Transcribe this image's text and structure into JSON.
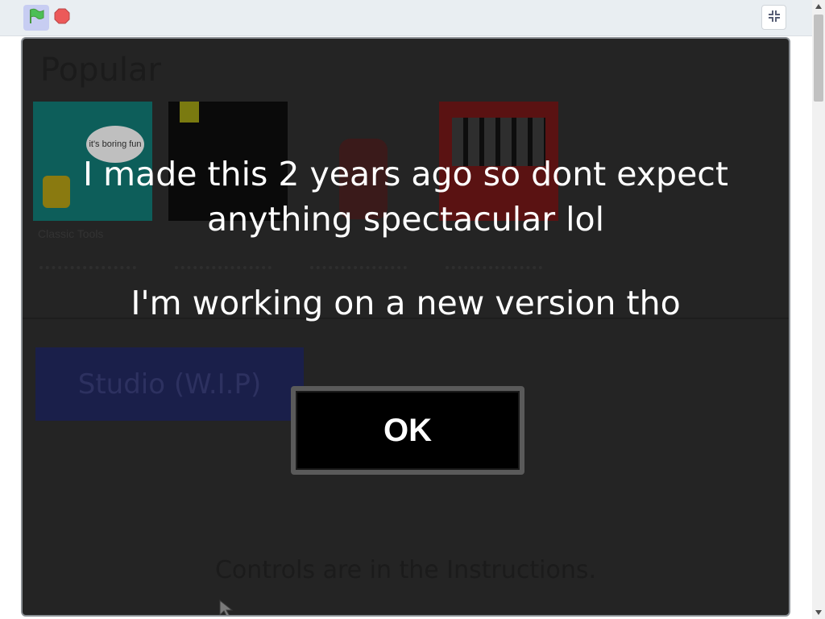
{
  "controls": {
    "green_flag_icon": "green-flag-icon",
    "stop_icon": "stop-icon",
    "fullscreen_icon": "exit-fullscreen-icon"
  },
  "stage_background": {
    "heading": "Popular",
    "cards": [
      {
        "label": "Classic Tools",
        "bubble_text": "it's boring fun",
        "color": "#0d6b66"
      },
      {
        "label": "",
        "color": "#0a0a0a"
      },
      {
        "label": "",
        "color": "#1f1f1f"
      },
      {
        "label": "",
        "color": "#6b1010"
      }
    ],
    "studio_button": "Studio (W.I.P)",
    "controls_hint": "Controls are in the Instructions."
  },
  "dialog": {
    "message_line1": "I made this 2 years ago so dont expect",
    "message_line2": "anything spectacular lol",
    "message_line3": "I'm working on a new version tho",
    "ok_label": "OK"
  },
  "colors": {
    "stage_bg": "#242424",
    "flag_green": "#4cbf56",
    "stop_red": "#ec5959"
  }
}
